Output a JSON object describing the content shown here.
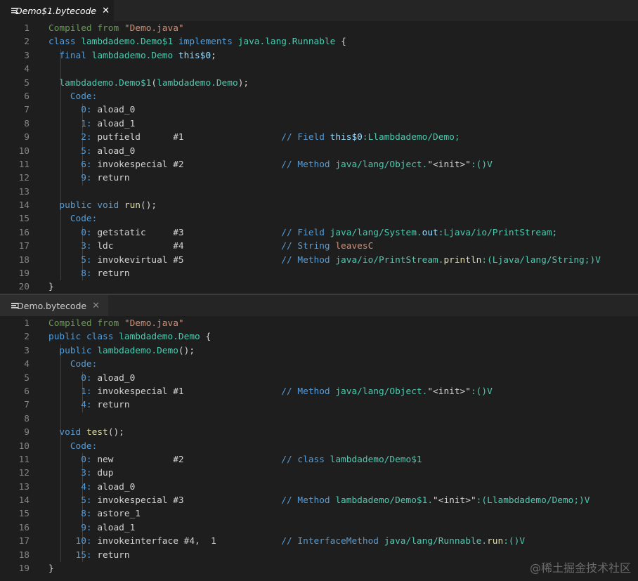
{
  "tabs": {
    "top": {
      "label": "Demo$1.bytecode",
      "close": "✕"
    },
    "bottom": {
      "label": "Demo.bytecode",
      "close": "✕"
    }
  },
  "watermark": "@稀土掘金技术社区",
  "editor_top": [
    {
      "n": "1",
      "g": 0,
      "t": [
        [
          "Compiled from ",
          "cm"
        ],
        [
          "\"Demo.java\"",
          "str"
        ]
      ]
    },
    {
      "n": "2",
      "g": 0,
      "t": [
        [
          "class ",
          "kw"
        ],
        [
          "lambdademo.Demo$1 ",
          "type"
        ],
        [
          "implements ",
          "kw"
        ],
        [
          "java.lang.Runnable ",
          "type"
        ],
        [
          "{",
          "plain"
        ]
      ]
    },
    {
      "n": "3",
      "g": 1,
      "t": [
        [
          "  final ",
          "kw"
        ],
        [
          "lambdademo.Demo ",
          "type"
        ],
        [
          "this$0",
          "var"
        ],
        [
          ";",
          "plain"
        ]
      ]
    },
    {
      "n": "4",
      "g": 1,
      "t": []
    },
    {
      "n": "5",
      "g": 1,
      "t": [
        [
          "  lambdademo.Demo$1",
          "type"
        ],
        [
          "(",
          "plain"
        ],
        [
          "lambdademo.Demo",
          "type"
        ],
        [
          ");",
          "plain"
        ]
      ]
    },
    {
      "n": "6",
      "g": 1,
      "t": [
        [
          "    Code:",
          "kw"
        ]
      ]
    },
    {
      "n": "7",
      "g": 2,
      "t": [
        [
          "      0: ",
          "kw"
        ],
        [
          "aload_0",
          "plain"
        ]
      ]
    },
    {
      "n": "8",
      "g": 2,
      "t": [
        [
          "      1: ",
          "kw"
        ],
        [
          "aload_1",
          "plain"
        ]
      ]
    },
    {
      "n": "9",
      "g": 2,
      "t": [
        [
          "      2: ",
          "kw"
        ],
        [
          "putfield      #1                  ",
          "plain"
        ],
        [
          "// Field ",
          "kw"
        ],
        [
          "this$0",
          "var"
        ],
        [
          ":Llambdademo/Demo;",
          "type"
        ]
      ]
    },
    {
      "n": "10",
      "g": 2,
      "t": [
        [
          "      5: ",
          "kw"
        ],
        [
          "aload_0",
          "plain"
        ]
      ]
    },
    {
      "n": "11",
      "g": 2,
      "t": [
        [
          "      6: ",
          "kw"
        ],
        [
          "invokespecial #2                  ",
          "plain"
        ],
        [
          "// Method ",
          "kw"
        ],
        [
          "java/lang/Object.",
          "type"
        ],
        [
          "\"<init>\"",
          "plain"
        ],
        [
          ":()V",
          "type"
        ]
      ]
    },
    {
      "n": "12",
      "g": 2,
      "t": [
        [
          "      9: ",
          "kw"
        ],
        [
          "return",
          "plain"
        ]
      ]
    },
    {
      "n": "13",
      "g": 1,
      "t": []
    },
    {
      "n": "14",
      "g": 1,
      "t": [
        [
          "  public ",
          "kw"
        ],
        [
          "void ",
          "kw"
        ],
        [
          "run",
          "fn"
        ],
        [
          "();",
          "plain"
        ]
      ]
    },
    {
      "n": "15",
      "g": 1,
      "t": [
        [
          "    Code:",
          "kw"
        ]
      ]
    },
    {
      "n": "16",
      "g": 2,
      "t": [
        [
          "      0: ",
          "kw"
        ],
        [
          "getstatic     #3                  ",
          "plain"
        ],
        [
          "// Field ",
          "kw"
        ],
        [
          "java/lang/System.",
          "type"
        ],
        [
          "out",
          "var"
        ],
        [
          ":Ljava/io/PrintStream;",
          "type"
        ]
      ]
    },
    {
      "n": "17",
      "g": 2,
      "t": [
        [
          "      3: ",
          "kw"
        ],
        [
          "ldc           #4                  ",
          "plain"
        ],
        [
          "// String ",
          "kw"
        ],
        [
          "leavesC",
          "str"
        ]
      ]
    },
    {
      "n": "18",
      "g": 2,
      "t": [
        [
          "      5: ",
          "kw"
        ],
        [
          "invokevirtual #5                  ",
          "plain"
        ],
        [
          "// Method ",
          "kw"
        ],
        [
          "java/io/PrintStream.",
          "type"
        ],
        [
          "println",
          "fn"
        ],
        [
          ":(Ljava/lang/String;)V",
          "type"
        ]
      ]
    },
    {
      "n": "19",
      "g": 2,
      "t": [
        [
          "      8: ",
          "kw"
        ],
        [
          "return",
          "plain"
        ]
      ]
    },
    {
      "n": "20",
      "g": 0,
      "t": [
        [
          "}",
          "plain"
        ]
      ]
    }
  ],
  "editor_bottom": [
    {
      "n": "1",
      "g": 0,
      "t": [
        [
          "Compiled from ",
          "cm"
        ],
        [
          "\"Demo.java\"",
          "str"
        ]
      ]
    },
    {
      "n": "2",
      "g": 0,
      "t": [
        [
          "public ",
          "kw"
        ],
        [
          "class ",
          "kw"
        ],
        [
          "lambdademo.Demo ",
          "type"
        ],
        [
          "{",
          "plain"
        ]
      ]
    },
    {
      "n": "3",
      "g": 1,
      "t": [
        [
          "  public ",
          "kw"
        ],
        [
          "lambdademo.Demo",
          "type"
        ],
        [
          "();",
          "plain"
        ]
      ]
    },
    {
      "n": "4",
      "g": 1,
      "t": [
        [
          "    Code:",
          "kw"
        ]
      ]
    },
    {
      "n": "5",
      "g": 2,
      "t": [
        [
          "      0: ",
          "kw"
        ],
        [
          "aload_0",
          "plain"
        ]
      ]
    },
    {
      "n": "6",
      "g": 2,
      "t": [
        [
          "      1: ",
          "kw"
        ],
        [
          "invokespecial #1                  ",
          "plain"
        ],
        [
          "// Method ",
          "kw"
        ],
        [
          "java/lang/Object.",
          "type"
        ],
        [
          "\"<init>\"",
          "plain"
        ],
        [
          ":()V",
          "type"
        ]
      ]
    },
    {
      "n": "7",
      "g": 2,
      "t": [
        [
          "      4: ",
          "kw"
        ],
        [
          "return",
          "plain"
        ]
      ]
    },
    {
      "n": "8",
      "g": 1,
      "t": []
    },
    {
      "n": "9",
      "g": 1,
      "t": [
        [
          "  void ",
          "kw"
        ],
        [
          "test",
          "fn"
        ],
        [
          "();",
          "plain"
        ]
      ]
    },
    {
      "n": "10",
      "g": 1,
      "t": [
        [
          "    Code:",
          "kw"
        ]
      ]
    },
    {
      "n": "11",
      "g": 2,
      "t": [
        [
          "      0: ",
          "kw"
        ],
        [
          "new           #2                  ",
          "plain"
        ],
        [
          "// class ",
          "kw"
        ],
        [
          "lambdademo/Demo$1",
          "type"
        ]
      ]
    },
    {
      "n": "12",
      "g": 2,
      "t": [
        [
          "      3: ",
          "kw"
        ],
        [
          "dup",
          "plain"
        ]
      ]
    },
    {
      "n": "13",
      "g": 2,
      "t": [
        [
          "      4: ",
          "kw"
        ],
        [
          "aload_0",
          "plain"
        ]
      ]
    },
    {
      "n": "14",
      "g": 2,
      "t": [
        [
          "      5: ",
          "kw"
        ],
        [
          "invokespecial #3                  ",
          "plain"
        ],
        [
          "// Method ",
          "kw"
        ],
        [
          "lambdademo/Demo$1.",
          "type"
        ],
        [
          "\"<init>\"",
          "plain"
        ],
        [
          ":(Llambdademo/Demo;)V",
          "type"
        ]
      ]
    },
    {
      "n": "15",
      "g": 2,
      "t": [
        [
          "      8: ",
          "kw"
        ],
        [
          "astore_1",
          "plain"
        ]
      ]
    },
    {
      "n": "16",
      "g": 2,
      "t": [
        [
          "      9: ",
          "kw"
        ],
        [
          "aload_1",
          "plain"
        ]
      ]
    },
    {
      "n": "17",
      "g": 2,
      "t": [
        [
          "     10: ",
          "kw"
        ],
        [
          "invokeinterface #4,  1            ",
          "plain"
        ],
        [
          "// InterfaceMethod ",
          "kw"
        ],
        [
          "java/lang/Runnable.",
          "type"
        ],
        [
          "run",
          "fn"
        ],
        [
          ":()V",
          "type"
        ]
      ]
    },
    {
      "n": "18",
      "g": 2,
      "t": [
        [
          "     15: ",
          "kw"
        ],
        [
          "return",
          "plain"
        ]
      ]
    },
    {
      "n": "19",
      "g": 0,
      "t": [
        [
          "}",
          "plain"
        ]
      ]
    }
  ]
}
